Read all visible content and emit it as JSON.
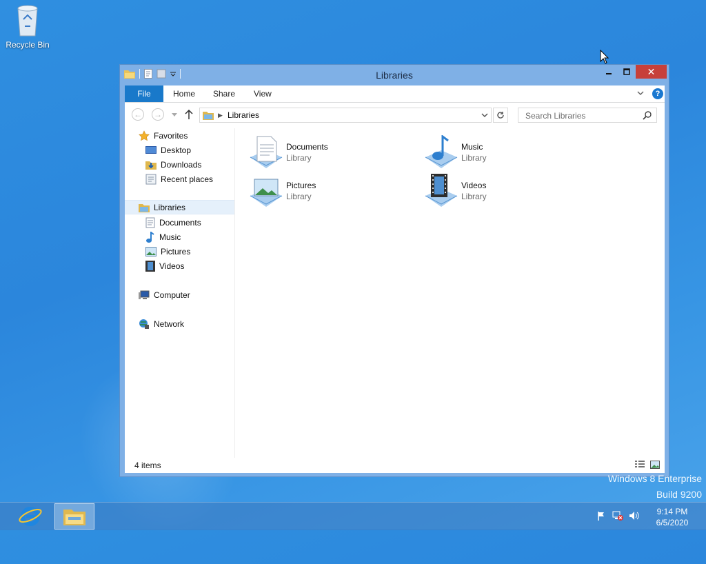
{
  "desktop": {
    "recycle_bin_label": "Recycle Bin",
    "watermark_line1": "Windows 8 Enterprise",
    "watermark_line2": "Build 9200"
  },
  "window": {
    "title": "Libraries",
    "close_glyph": "✕"
  },
  "ribbon": {
    "tabs": [
      {
        "label": "File"
      },
      {
        "label": "Home"
      },
      {
        "label": "Share"
      },
      {
        "label": "View"
      }
    ],
    "help_glyph": "?"
  },
  "address": {
    "breadcrumb": "Libraries",
    "search_placeholder": "Search Libraries"
  },
  "nav": {
    "favorites": "Favorites",
    "desktop": "Desktop",
    "downloads": "Downloads",
    "recent": "Recent places",
    "libraries": "Libraries",
    "lib_documents": "Documents",
    "lib_music": "Music",
    "lib_pictures": "Pictures",
    "lib_videos": "Videos",
    "computer": "Computer",
    "network": "Network"
  },
  "items": [
    {
      "name": "Documents",
      "type": "Library",
      "icon": "documents-library-icon"
    },
    {
      "name": "Music",
      "type": "Library",
      "icon": "music-library-icon"
    },
    {
      "name": "Pictures",
      "type": "Library",
      "icon": "pictures-library-icon"
    },
    {
      "name": "Videos",
      "type": "Library",
      "icon": "videos-library-icon"
    }
  ],
  "status": {
    "count": "4 items"
  },
  "taskbar": {
    "time": "9:14 PM",
    "date": "6/5/2020"
  },
  "colors": {
    "accent": "#1979ca",
    "close": "#c7403a",
    "desktop": "#2f8fe0"
  }
}
